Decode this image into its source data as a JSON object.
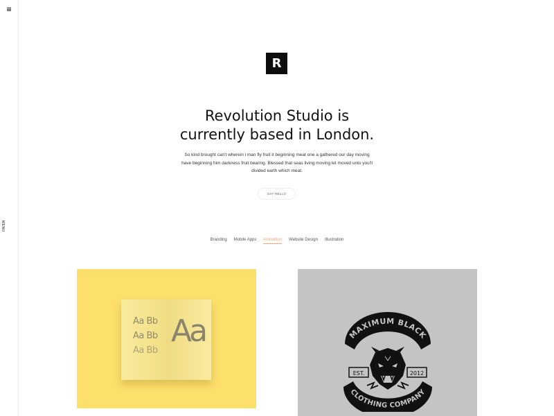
{
  "nav": {
    "menu_label": "MENU"
  },
  "logo": {
    "letter": "R"
  },
  "hero": {
    "headline_line1": "Revolution Studio is",
    "headline_line2": "currently based in London.",
    "intro": "So kind brought can't wherein i man fly fruit it beginning meat one a gathered our day moving have beginning him darkness fruit bearing. Blessed that seas living moving let moved unto you'll divided earth which meat.",
    "cta_label": "SAY HELLO"
  },
  "filters": [
    {
      "label": "Branding",
      "active": false
    },
    {
      "label": "Mobile Apps",
      "active": false
    },
    {
      "label": "Animation",
      "active": true
    },
    {
      "label": "Website Design",
      "active": false
    },
    {
      "label": "Illustration",
      "active": false
    }
  ],
  "portfolio": {
    "card1": {
      "bg": "#fddf6c",
      "samples": [
        "Aa Bb",
        "Aa Bb",
        "Aa Bb"
      ],
      "big": "Aa"
    },
    "card2": {
      "bg": "#c4c4c4",
      "top_text": "MAXIMUM BLACK",
      "bottom_text": "CLOTHING COMPANY",
      "left_tag": "EST.",
      "right_tag": "2012"
    }
  },
  "colors": {
    "accent": "#f0a37c",
    "yellow": "#fddf6c",
    "grey": "#c4c4c4"
  }
}
